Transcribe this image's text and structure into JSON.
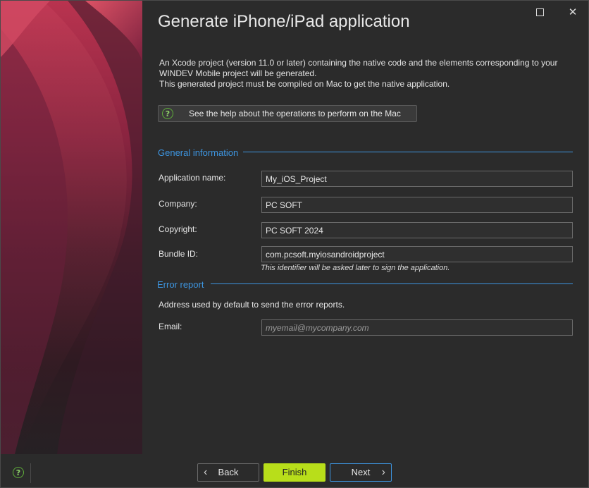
{
  "window": {
    "title": "Generate iPhone/iPad application",
    "maximize_icon": "maximize-icon",
    "close_icon": "close-icon",
    "close_glyph": "✕"
  },
  "intro": {
    "line1": "An Xcode project (version 11.0 or later) containing the native code and the elements corresponding to your",
    "line2": "WINDEV Mobile project will be generated.",
    "line3": "This generated project must be compiled on Mac to get the native application."
  },
  "help_button": {
    "icon": "help-icon",
    "label": "See the help about the operations to perform on the Mac"
  },
  "general": {
    "title": "General information",
    "app_name_label": "Application name:",
    "app_name_value": "My_iOS_Project",
    "company_label": "Company:",
    "company_value": "PC SOFT",
    "copyright_label": "Copyright:",
    "copyright_value": "PC SOFT 2024",
    "bundle_label": "Bundle ID:",
    "bundle_value": "com.pcsoft.myiosandroidproject",
    "bundle_hint": "This identifier will be asked later to sign the application."
  },
  "error_report": {
    "title": "Error report",
    "note": "Address used by default to send the error reports.",
    "email_label": "Email:",
    "email_placeholder": "myemail@mycompany.com",
    "email_value": ""
  },
  "footer": {
    "help_icon": "help-icon",
    "back_label": "Back",
    "finish_label": "Finish",
    "next_label": "Next"
  },
  "colors": {
    "accent": "#3d95e0",
    "finish": "#b8de1a",
    "background": "#2b2b2b"
  }
}
